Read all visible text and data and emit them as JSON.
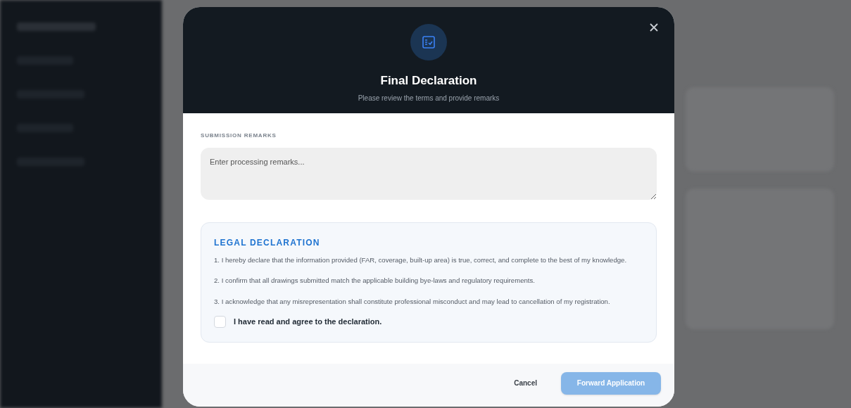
{
  "dialog": {
    "title": "Final Declaration",
    "subtitle": "Please review the terms and provide remarks",
    "remarks": {
      "label": "SUBMISSION REMARKS",
      "placeholder": "Enter processing remarks..."
    },
    "declaration": {
      "heading": "LEGAL DECLARATION",
      "items": [
        "1. I hereby declare that the information provided (FAR, coverage, built-up area) is true, correct, and complete to the best of my knowledge.",
        "2. I confirm that all drawings submitted match the applicable building bye-laws and regulatory requirements.",
        "3. I acknowledge that any misrepresentation shall constitute professional misconduct and may lead to cancellation of my registration."
      ],
      "agree": {
        "label": "I have read and agree to the declaration.",
        "checked": false
      }
    },
    "buttons": [
      {
        "label": "Cancel",
        "kind": "secondary",
        "disabled": false
      },
      {
        "label": "Forward Application",
        "kind": "primary",
        "disabled": true
      }
    ]
  }
}
